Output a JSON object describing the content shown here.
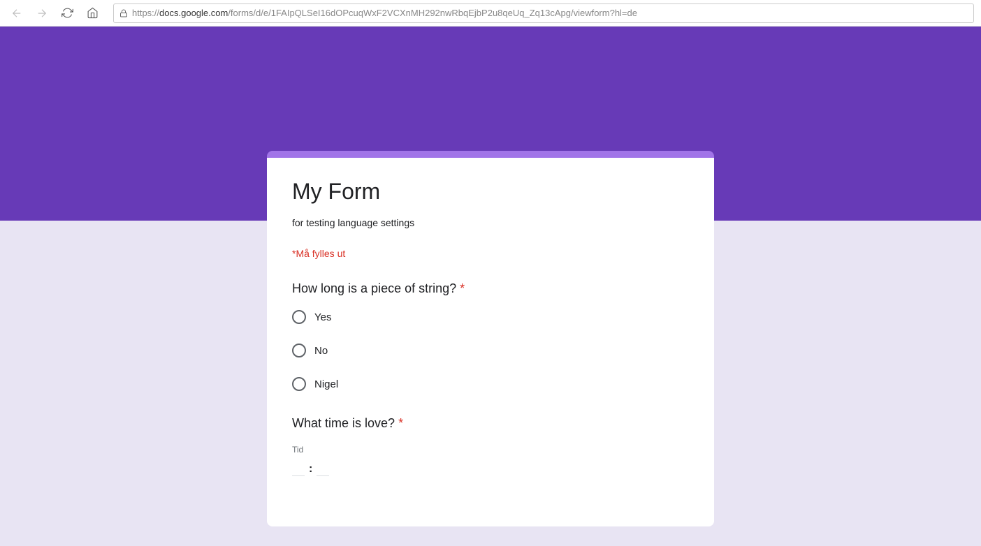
{
  "browser": {
    "url_prefix": "https://",
    "url_domain": "docs.google.com",
    "url_path": "/forms/d/e/1FAIpQLSeI16dOPcuqWxF2VCXnMH292nwRbqEjbP2u8qeUq_Zq13cApg/viewform?hl=de"
  },
  "form": {
    "title": "My Form",
    "description": "for testing language settings",
    "required_note": "*Må fylles ut",
    "questions": [
      {
        "title": "How long is a piece of string? ",
        "required": "*",
        "options": [
          "Yes",
          "No",
          "Nigel"
        ]
      },
      {
        "title": "What time is love? ",
        "required": "*",
        "time_label": "Tid",
        "time_separator": ":"
      }
    ]
  }
}
